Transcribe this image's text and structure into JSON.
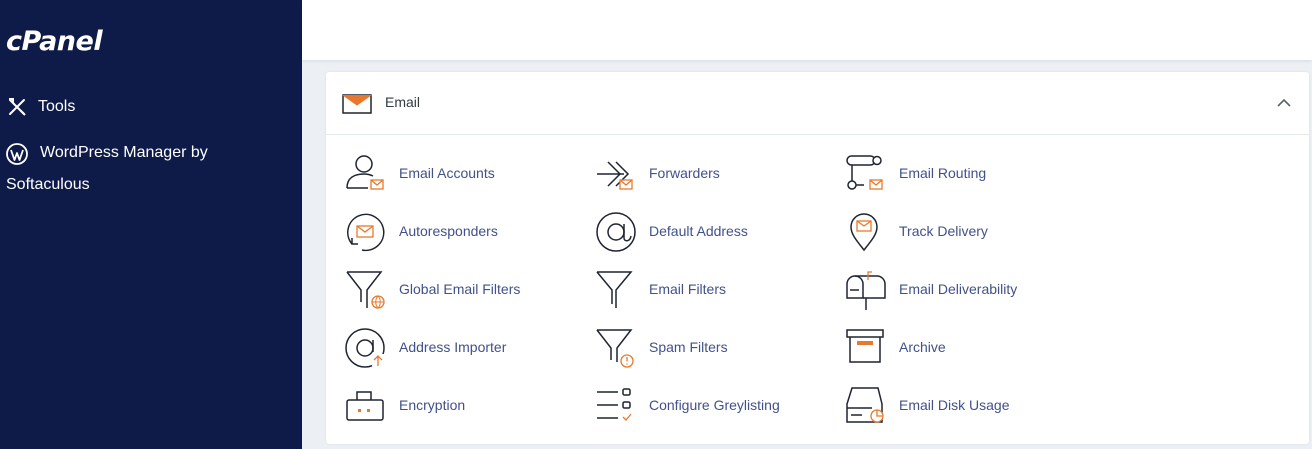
{
  "brand": {
    "logo_text": "cPanel"
  },
  "sidebar": {
    "items": [
      {
        "label": "Tools",
        "icon": "tools-icon"
      },
      {
        "label_line1": "WordPress Manager by",
        "label_line2": "Softaculous",
        "icon": "wordpress-icon"
      }
    ]
  },
  "section": {
    "title": "Email",
    "icon": "envelope-icon",
    "expanded": true,
    "tools": [
      {
        "label": "Email Accounts",
        "icon": "email-accounts-icon"
      },
      {
        "label": "Forwarders",
        "icon": "forwarders-icon"
      },
      {
        "label": "Email Routing",
        "icon": "email-routing-icon"
      },
      {
        "label": "Autoresponders",
        "icon": "autoresponders-icon"
      },
      {
        "label": "Default Address",
        "icon": "at-sign-icon"
      },
      {
        "label": "Track Delivery",
        "icon": "track-delivery-icon"
      },
      {
        "label": "Global Email Filters",
        "icon": "global-filter-icon"
      },
      {
        "label": "Email Filters",
        "icon": "filter-icon"
      },
      {
        "label": "Email Deliverability",
        "icon": "mailbox-icon"
      },
      {
        "label": "Address Importer",
        "icon": "address-importer-icon"
      },
      {
        "label": "Spam Filters",
        "icon": "spam-filter-icon"
      },
      {
        "label": "Archive",
        "icon": "archive-icon"
      },
      {
        "label": "Encryption",
        "icon": "encryption-icon"
      },
      {
        "label": "Configure Greylisting",
        "icon": "greylisting-icon"
      },
      {
        "label": "Email Disk Usage",
        "icon": "disk-usage-icon"
      }
    ]
  },
  "colors": {
    "sidebar_bg": "#0e1b48",
    "link": "#41518a",
    "accent_orange": "#e8782c",
    "icon_stroke": "#1f2430"
  }
}
